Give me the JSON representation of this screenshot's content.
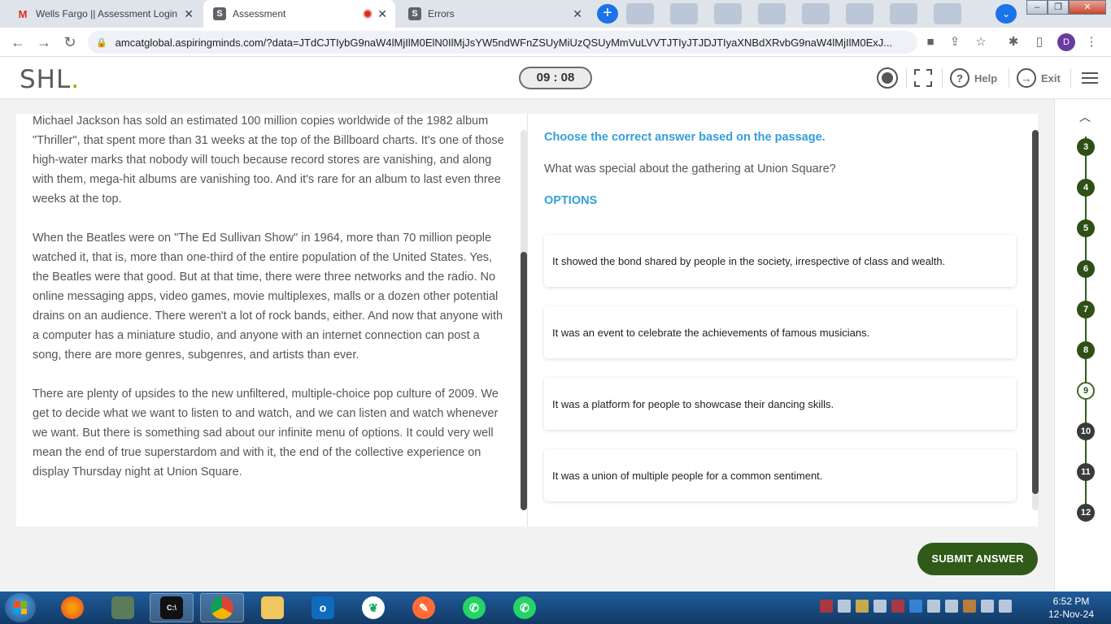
{
  "browser": {
    "tabs": [
      {
        "title": "Wells Fargo || Assessment Login P",
        "icon": "gmail-icon"
      },
      {
        "title": "Assessment",
        "icon": "shl-icon"
      },
      {
        "title": "Errors",
        "icon": "shl-icon"
      }
    ],
    "url": "amcatglobal.aspiringminds.com/?data=JTdCJTIybG9naW4lMjIlM0ElN0IlMjJsYW5ndWFnZSUyMiUzQSUyMmVuLVVTJTIyJTJDJTIyaXNBdXRvbG9naW4lMjIlM0ExJ...",
    "profile_initial": "D"
  },
  "header": {
    "logo": "SHL",
    "logo_dot": ".",
    "timer": "09 : 08",
    "help_label": "Help",
    "exit_label": "Exit"
  },
  "passage": {
    "paragraphs": [
      "Michael Jackson has sold an estimated 100 million copies worldwide of the 1982 album \"Thriller\", that spent more than 31 weeks at the top of the Billboard charts. It's one of those high-water marks that nobody will touch because record stores are vanishing, and along with them, mega-hit albums are vanishing too. And it's rare for an album to last even three weeks at the top.",
      "When the Beatles were on \"The Ed Sullivan Show\" in 1964, more than 70 million people watched it, that is, more than one-third of the entire population of the United States. Yes, the Beatles were that good. But at that time, there were three networks and the radio. No online messaging apps, video games, movie multiplexes, malls or a dozen other potential drains on an audience. There weren't a lot of rock bands, either. And now that anyone with a computer has a miniature studio, and anyone with an internet connection can post a song, there are more genres, subgenres, and artists than ever.",
      "There are plenty of upsides to the new unfiltered, multiple-choice pop culture of 2009. We get to decide what we want to listen to and watch, and we can listen and watch whenever we want. But there is something sad about our infinite menu of options. It could very well mean the end of true superstardom and with it, the end of the collective experience on display Thursday night at Union Square."
    ]
  },
  "question": {
    "instruction": "Choose the correct answer based on the passage.",
    "text": "What was special about the gathering at Union Square?",
    "options_heading": "OPTIONS",
    "options": [
      "It showed the bond shared by people in the society, irrespective of class and wealth.",
      "It was an event to celebrate the achievements of famous musicians.",
      "It was a platform for people to showcase their dancing skills.",
      "It was a union of multiple people for a common sentiment."
    ]
  },
  "navigator": {
    "numbers": [
      "3",
      "4",
      "5",
      "6",
      "7",
      "8",
      "9",
      "10",
      "11",
      "12"
    ],
    "current": "9"
  },
  "submit_label": "SUBMIT ANSWER",
  "taskbar": {
    "time": "6:52 PM",
    "date": "12-Nov-24"
  },
  "colors": {
    "accent_blue": "#33a0d8",
    "brand_green": "#2f5a17",
    "logo_dot": "#7ab700"
  }
}
